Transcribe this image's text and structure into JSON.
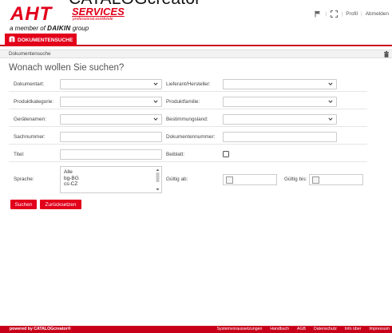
{
  "page_title": "CATALOGcreator",
  "logo": {
    "brand": "AHT",
    "services": "SERVICES",
    "services_sub": "professional.worldwide",
    "member_prefix": "a member of",
    "member_brand": "DAIKIN",
    "member_suffix": "group"
  },
  "topbar": {
    "profile": "Profil",
    "logout": "Abmelden",
    "icons": [
      "flag-icon",
      "fullscreen-icon"
    ]
  },
  "tabs": [
    {
      "label": "DOKUMENTENSUCHE",
      "active": true
    }
  ],
  "panel": {
    "title": "Dokumentensuche",
    "heading": "Wonach wollen Sie suchen?"
  },
  "form": {
    "document_type": {
      "label": "Dokumentart:",
      "value": ""
    },
    "supplier": {
      "label": "Lieferant/Hersteller:",
      "value": ""
    },
    "product_category": {
      "label": "Produktkategorie:",
      "value": ""
    },
    "product_family": {
      "label": "Produktfamilie:",
      "value": ""
    },
    "device_names": {
      "label": "Gerätenamen:",
      "value": ""
    },
    "destination_country": {
      "label": "Bestimmungsland:",
      "value": ""
    },
    "item_number": {
      "label": "Sachnummer:",
      "value": ""
    },
    "document_number": {
      "label": "Dokumentennummer:",
      "value": ""
    },
    "title": {
      "label": "Titel:",
      "value": ""
    },
    "attachment": {
      "label": "Beiblatt:",
      "checked": false
    },
    "language": {
      "label": "Sprache:",
      "options": [
        "Alle",
        "bg-BG",
        "cs-CZ"
      ]
    },
    "valid_from": {
      "label": "Gültig ab:",
      "value": ""
    },
    "valid_to": {
      "label": "Gültig bis:",
      "value": ""
    }
  },
  "buttons": {
    "search": "Suchen",
    "reset": "Zurücksetzen"
  },
  "footer": {
    "powered_by": "powered by CATALOGcreator®",
    "links": [
      "Systemvoraussetzungen",
      "Handbuch",
      "AGB",
      "Datenschutz",
      "Info über",
      "Impressum"
    ]
  },
  "colors": {
    "brand_red": "#e2001a",
    "footer_red": "#c8001a"
  }
}
